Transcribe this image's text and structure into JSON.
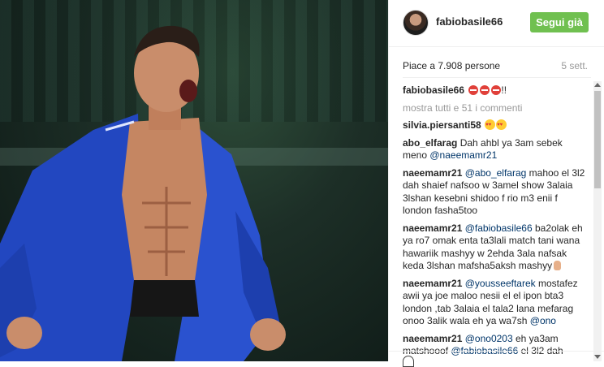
{
  "post": {
    "username": "fabiobasile66",
    "follow_label": "Segui già",
    "likes_text": "Piace a 7.908 persone",
    "date_text": "5 sett.",
    "caption_suffix": "!!",
    "more_comments": "mostra tutti e 51 i commenti"
  },
  "comments": [
    {
      "user": "silvia.piersanti58",
      "text": ""
    },
    {
      "user": "abo_elfarag",
      "text": "Dah ahbl ya 3am sebek meno ",
      "mention": "@naeemamr21",
      "after": ""
    },
    {
      "user": "naeemamr21",
      "mention": "@abo_elfarag",
      "text": " mahoo el 3l2 dah shaief nafsoo w 3amel show 3alaia 3lshan kesebni shidoo f rio m3 enii f london fasha5too"
    },
    {
      "user": "naeemamr21",
      "mention": "@fabiobasile66",
      "text": " ba2olak eh ya ro7 omak enta ta3lali match tani wana hawariik mashyy w 2ehda 3ala nafsak keda 3lshan mafsha5aksh mashyy"
    },
    {
      "user": "naeemamr21",
      "mention": "@yousseeftarek",
      "text": " mostafez awii ya joe maloo nesii el el ipon bta3 london ,tab 3alaia el tala2 lana mefarag onoo 3alik wala eh ya wa7sh ",
      "mention2": "@ono"
    },
    {
      "user": "naeemamr21",
      "mention": "@ono0203",
      "text": " eh ya3am matshooof ",
      "mention2": "@fabiobasile66",
      "after": " el 3l2 dah"
    }
  ],
  "icons": [
    "heart-icon",
    "no-entry-emoji",
    "heart-eyes-emoji",
    "middle-finger-emoji"
  ],
  "colors": {
    "follow": "#70c050",
    "mention": "#003569",
    "muted": "#999999"
  }
}
